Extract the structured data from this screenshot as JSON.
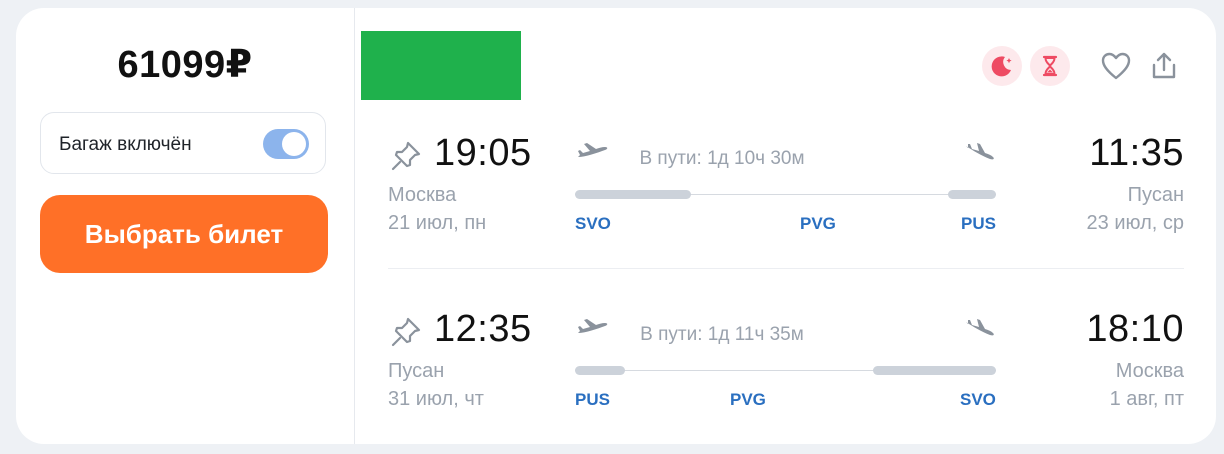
{
  "price": "61099₽",
  "baggage": {
    "label": "Багаж включён",
    "enabled": true
  },
  "select_button": "Выбрать билет",
  "airline_logo_color": "#1fb14c",
  "badges": [
    "moon-icon",
    "hourglass-icon"
  ],
  "actions": [
    "favorite-heart-icon",
    "share-icon"
  ],
  "accent_color": "#ff7027",
  "segments": [
    {
      "departure": {
        "time": "19:05",
        "city": "Москва",
        "date": "21 июл, пн"
      },
      "duration": "В пути: 1д 10ч 30м",
      "arrival": {
        "time": "11:35",
        "city": "Пусан",
        "date": "23 июл, ср"
      },
      "airports": [
        "SVO",
        "PVG",
        "PUS"
      ]
    },
    {
      "departure": {
        "time": "12:35",
        "city": "Пусан",
        "date": "31 июл, чт"
      },
      "duration": "В пути: 1д 11ч 35м",
      "arrival": {
        "time": "18:10",
        "city": "Москва",
        "date": "1 авг, пт"
      },
      "airports": [
        "PUS",
        "PVG",
        "SVO"
      ]
    }
  ]
}
